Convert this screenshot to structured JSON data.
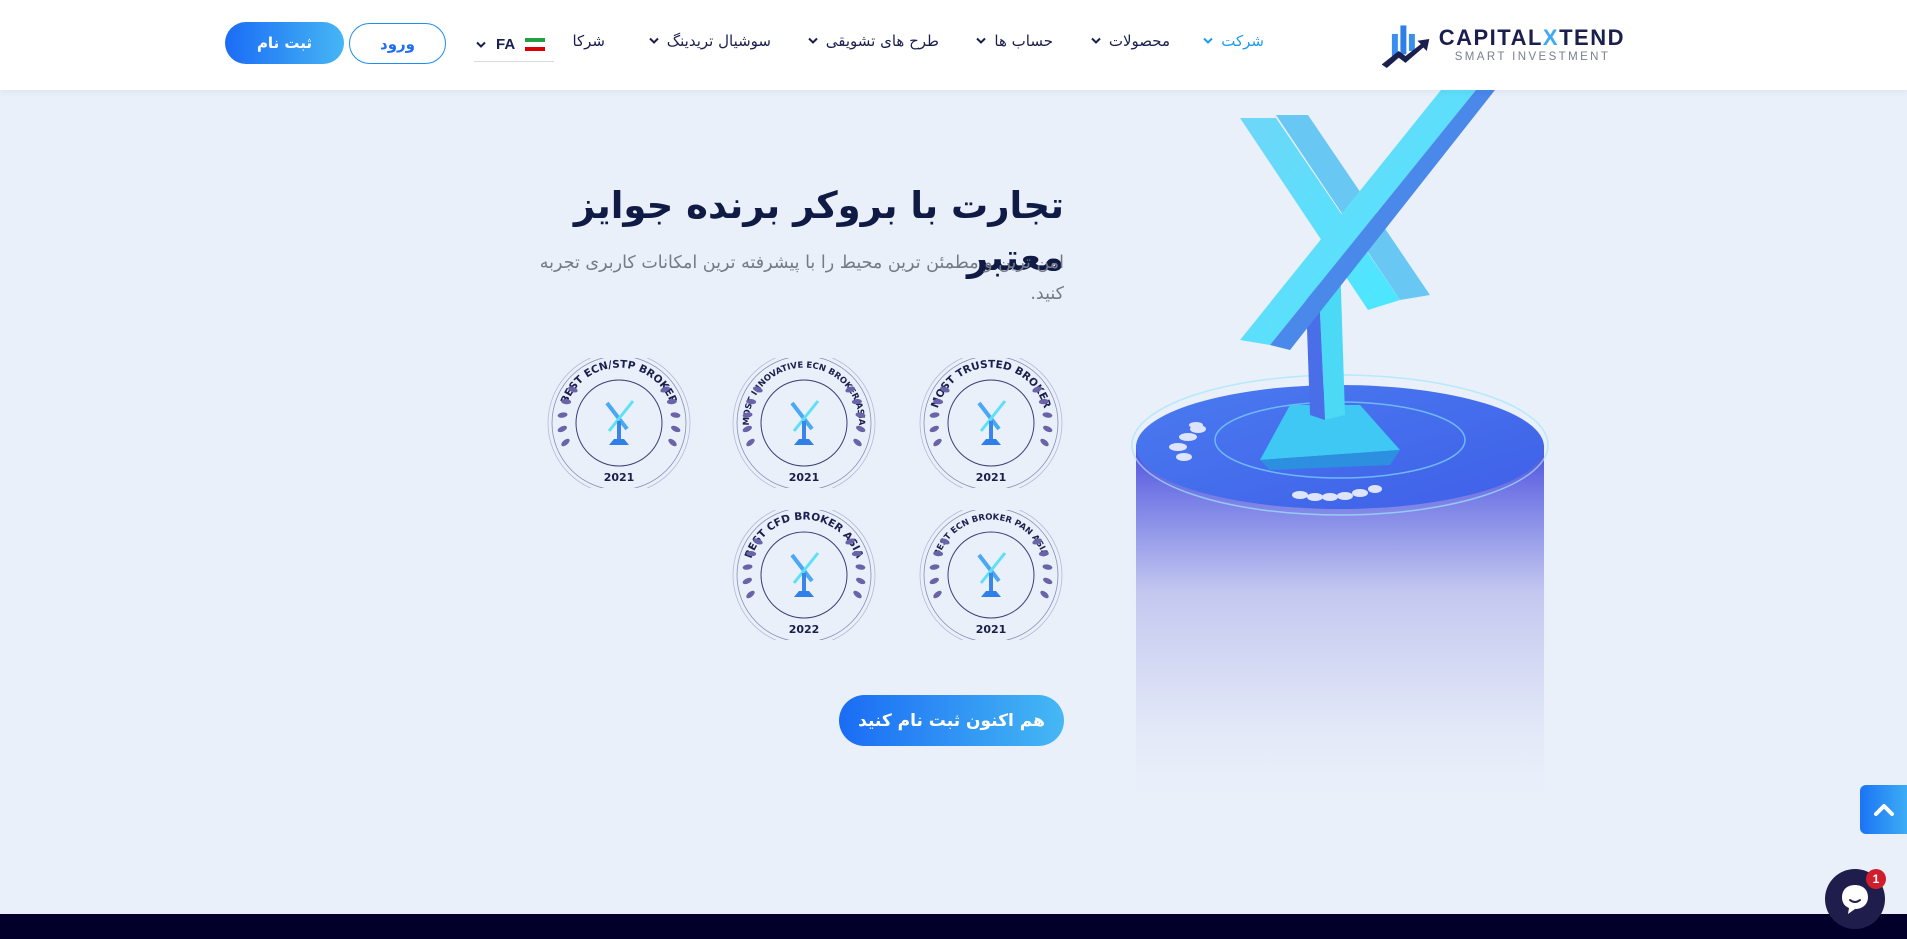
{
  "brand": {
    "name_prefix": "CAPITAL",
    "name_x": "X",
    "name_suffix": "TEND",
    "tagline": "SMART INVESTMENT"
  },
  "nav": {
    "items": [
      {
        "label": "شرکت",
        "has_dropdown": true,
        "active": true
      },
      {
        "label": "محصولات",
        "has_dropdown": true,
        "active": false
      },
      {
        "label": "حساب ها",
        "has_dropdown": true,
        "active": false
      },
      {
        "label": "طرح های تشویقی",
        "has_dropdown": true,
        "active": false
      },
      {
        "label": "سوشیال تریدینگ",
        "has_dropdown": true,
        "active": false
      },
      {
        "label": "شرکا",
        "has_dropdown": false,
        "active": false
      }
    ],
    "language": {
      "code": "FA",
      "flag": "iran-flag-icon"
    },
    "login_label": "ورود",
    "signup_label": "ثبت نام"
  },
  "hero": {
    "title": "تجارت با بروکر برنده جوایز معتبر",
    "subtitle": "امن ترین و مطمئن ترین محیط را با پیشرفته ترین امکانات کاربری تجربه کنید.",
    "cta_label": "هم اکنون ثبت نام کنید"
  },
  "awards": [
    {
      "title": "MOST TRUSTED BROKER",
      "year": "2021"
    },
    {
      "title": "MOST INNOVATIVE ECN BROKER ASIA",
      "year": "2021"
    },
    {
      "title": "BEST ECN/STP BROKER",
      "year": "2021"
    },
    {
      "title": "BEST ECN BROKER PAN ASIA",
      "year": "2021"
    },
    {
      "title": "BEST CFD BROKER ASIA",
      "year": "2022"
    }
  ],
  "floating": {
    "chat_unread_count": "1"
  },
  "colors": {
    "accent": "#1e9bf0",
    "button_gradient_start": "#1a6cf4",
    "button_gradient_end": "#45b8f4",
    "navy": "#0f1b45",
    "page_bg": "#e9f0fa",
    "footer_bg": "#02002a",
    "badge_purple": "#6b63a8"
  }
}
